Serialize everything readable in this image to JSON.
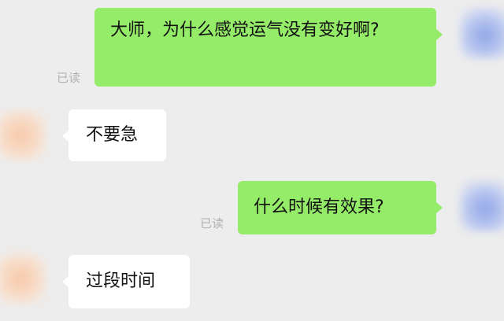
{
  "messages": [
    {
      "sender": "me",
      "text": "大师，为什么感觉运气没有变好啊?",
      "status": "已读"
    },
    {
      "sender": "other",
      "text": "不要急"
    },
    {
      "sender": "me",
      "text": "什么时候有效果?",
      "status": "已读"
    },
    {
      "sender": "other",
      "text": "过段时间"
    }
  ],
  "colors": {
    "background": "#ededed",
    "my_bubble": "#95ec69",
    "their_bubble": "#ffffff",
    "read_status": "#b2b2b2"
  },
  "icons": {
    "my_avatar": "user-avatar-icon",
    "their_avatar": "contact-avatar-icon"
  }
}
